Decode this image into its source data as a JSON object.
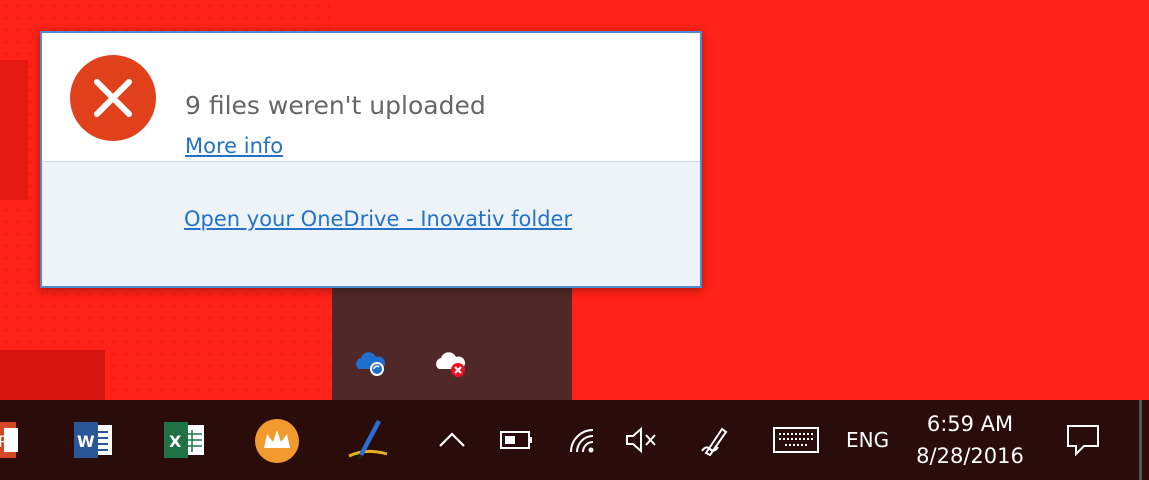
{
  "notification": {
    "title": "9 files weren't uploaded",
    "more_info_link": "More info",
    "open_folder_link": "Open your OneDrive - Inovativ folder",
    "icon": "error-x-icon",
    "accent_color": "#e0401a"
  },
  "tray_overflow": {
    "icons": [
      "onedrive-sync-icon",
      "onedrive-error-icon"
    ]
  },
  "taskbar": {
    "pinned_apps": [
      "powerpoint-icon",
      "word-icon",
      "excel-icon",
      "crown-app-icon",
      "pen-app-icon"
    ],
    "tray_icons": [
      "chevron-up-icon",
      "battery-icon",
      "wifi-icon",
      "volume-muted-icon",
      "pen-workspace-icon",
      "touch-keyboard-icon"
    ],
    "language": "ENG",
    "time": "6:59 AM",
    "date": "8/28/2016",
    "action_center_icon": "action-center-icon"
  },
  "colors": {
    "desktop_background": "#ff2218",
    "taskbar": "#2a0d0a",
    "link": "#2472c8"
  }
}
